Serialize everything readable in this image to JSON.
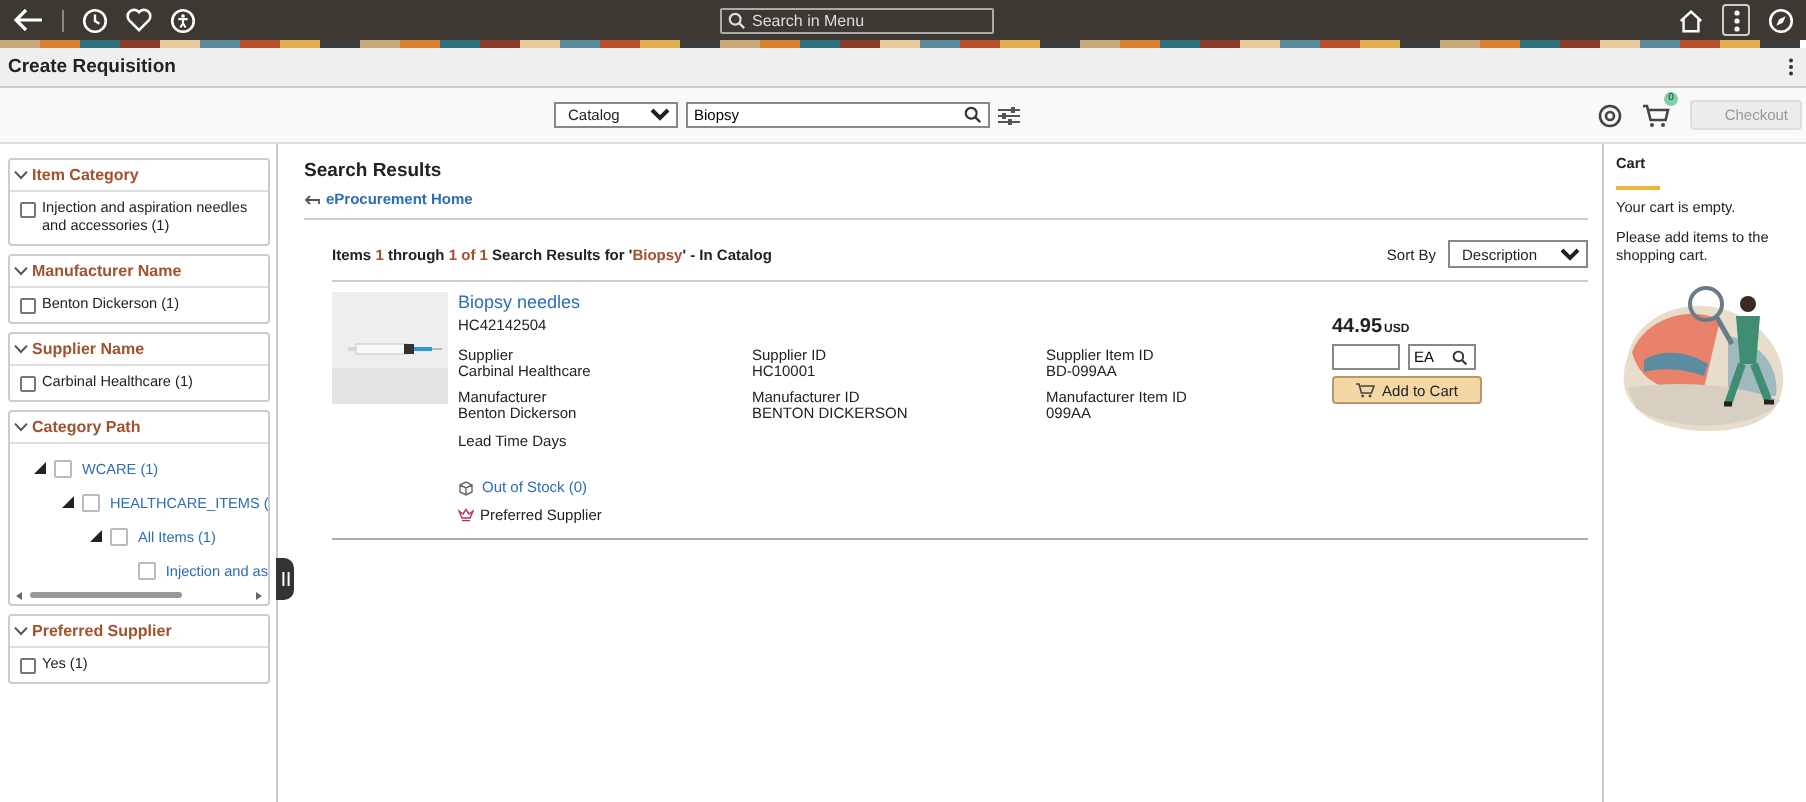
{
  "top_bar": {
    "search": {
      "placeholder": "Search in Menu"
    }
  },
  "page_title": "Create Requisition",
  "search_bar": {
    "scope": "Catalog",
    "query": "Biopsy"
  },
  "cart_badge": "0",
  "checkout": {
    "label": "Checkout",
    "disabled": true
  },
  "facets": [
    {
      "title": "Item Category",
      "kind": "list",
      "expanded": true,
      "options": [
        {
          "label": "Injection and aspiration needles and accessories (1)",
          "checked": false
        }
      ]
    },
    {
      "title": "Manufacturer Name",
      "kind": "list",
      "expanded": true,
      "options": [
        {
          "label": "Benton Dickerson (1)",
          "checked": false
        }
      ]
    },
    {
      "title": "Supplier Name",
      "kind": "list",
      "expanded": true,
      "options": [
        {
          "label": "Carbinal Healthcare (1)",
          "checked": false
        }
      ]
    },
    {
      "title": "Category Path",
      "kind": "tree",
      "expanded": true,
      "nodes": [
        {
          "label": "WCARE (1)",
          "checked": false,
          "expanded": true,
          "children": [
            {
              "label": "HEALTHCARE_ITEMS (",
              "checked": false,
              "expanded": true,
              "children": [
                {
                  "label": "All Items (1)",
                  "checked": false,
                  "expanded": true,
                  "children": [
                    {
                      "label": "Injection and as",
                      "checked": false
                    }
                  ]
                }
              ]
            }
          ]
        }
      ]
    },
    {
      "title": "Preferred Supplier",
      "kind": "list",
      "expanded": true,
      "options": [
        {
          "label": "Yes (1)",
          "checked": false
        }
      ]
    }
  ],
  "results": {
    "title": "Search Results",
    "home_link": "eProcurement Home",
    "summary": [
      {
        "text": "Items ",
        "highlight": false
      },
      {
        "text": "1",
        "highlight": true
      },
      {
        "text": " through ",
        "highlight": false
      },
      {
        "text": "1 of 1",
        "highlight": true
      },
      {
        "text": " Search Results for '",
        "highlight": false
      },
      {
        "text": "Biopsy",
        "highlight": true
      },
      {
        "text": "' - In Catalog",
        "highlight": false
      }
    ],
    "sort_label": "Sort By",
    "sort_value": "Description",
    "items": [
      {
        "name": "Biopsy needles",
        "code": "HC42142504",
        "image": {
          "kind": "picture"
        },
        "fields": [
          {
            "label": "Supplier",
            "value": "Carbinal Healthcare"
          },
          {
            "label": "Supplier ID",
            "value": "HC10001"
          },
          {
            "label": "Supplier Item ID",
            "value": "BD-099AA"
          },
          {
            "label": "Manufacturer",
            "value": "Benton Dickerson"
          },
          {
            "label": "Manufacturer ID",
            "value": "BENTON DICKERSON"
          },
          {
            "label": "Manufacturer Item ID",
            "value": "099AA"
          }
        ],
        "lead_time_label": "Lead Time Days",
        "stock": "Out of Stock (0)",
        "preferred": "Preferred Supplier",
        "price": "44.95",
        "currency": "USD",
        "uom": "EA",
        "add_label": "Add to Cart"
      }
    ]
  },
  "cart": {
    "title": "Cart",
    "empty": "Your cart is empty.",
    "hint": "Please add items to the shopping cart."
  }
}
